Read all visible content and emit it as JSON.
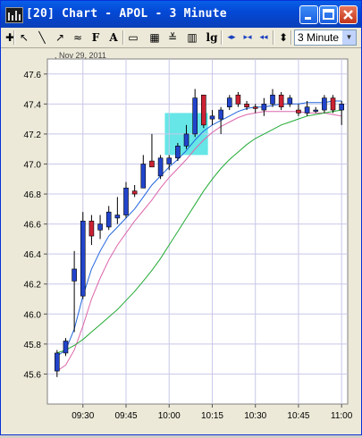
{
  "window": {
    "title": "[20] Chart - APOL - 3 Minute",
    "title_color": "#ffffff",
    "titlebar_color": "#0349d6"
  },
  "toolbar": {
    "tools": [
      {
        "name": "crosshair-icon",
        "glyph": "✚"
      },
      {
        "name": "pointer-icon",
        "glyph": "↖"
      },
      {
        "name": "line-icon",
        "glyph": "╲"
      },
      {
        "name": "ray-icon",
        "glyph": "↗"
      },
      {
        "name": "trend-icon",
        "glyph": "≈"
      },
      {
        "name": "fibonacci-icon",
        "glyph": "F"
      },
      {
        "name": "text-icon",
        "glyph": "A"
      },
      {
        "name": "page-icon",
        "glyph": "▭"
      },
      {
        "name": "grid-icon",
        "glyph": "▦"
      },
      {
        "name": "indicator-icon",
        "glyph": "≚"
      },
      {
        "name": "bars-icon",
        "glyph": "▥"
      },
      {
        "name": "log-scale-label",
        "glyph": "lg"
      },
      {
        "name": "scroll-both-icon",
        "glyph": "◂▸"
      },
      {
        "name": "scroll-left-icon",
        "glyph": "▸◂"
      },
      {
        "name": "scroll-end-icon",
        "glyph": "◂◂"
      },
      {
        "name": "zoom-icon",
        "glyph": "⬍"
      }
    ],
    "interval": "3 Minute"
  },
  "chart_data": {
    "type": "candlestick",
    "symbol": "APOL",
    "date_label": "Nov 29, 2011",
    "ylim": [
      45.4,
      47.7
    ],
    "y_ticks": [
      "47.6",
      "47.4",
      "47.2",
      "47.0",
      "46.8",
      "46.6",
      "46.4",
      "46.2",
      "46.0",
      "45.8",
      "45.6"
    ],
    "y_tick_values": [
      47.6,
      47.4,
      47.2,
      47.0,
      46.8,
      46.6,
      46.4,
      46.2,
      46.0,
      45.8,
      45.6
    ],
    "x_ticks": [
      "09:30",
      "09:45",
      "10:00",
      "10:15",
      "10:30",
      "10:45",
      "11:00"
    ],
    "x_tick_bars": [
      3,
      8,
      13,
      18,
      23,
      28,
      33
    ],
    "grid": true,
    "up_color": "#2244cc",
    "down_color": "#cc2233",
    "candles": [
      {
        "o": 45.62,
        "h": 45.76,
        "l": 45.58,
        "c": 45.74
      },
      {
        "o": 45.74,
        "h": 45.84,
        "l": 45.72,
        "c": 45.82
      },
      {
        "o": 46.22,
        "h": 46.42,
        "l": 45.88,
        "c": 46.3
      },
      {
        "o": 46.12,
        "h": 46.68,
        "l": 46.1,
        "c": 46.62
      },
      {
        "o": 46.62,
        "h": 46.66,
        "l": 46.46,
        "c": 46.52
      },
      {
        "o": 46.56,
        "h": 46.66,
        "l": 46.5,
        "c": 46.6
      },
      {
        "o": 46.58,
        "h": 46.72,
        "l": 46.56,
        "c": 46.68
      },
      {
        "o": 46.64,
        "h": 46.78,
        "l": 46.6,
        "c": 46.66
      },
      {
        "o": 46.66,
        "h": 46.88,
        "l": 46.64,
        "c": 46.84
      },
      {
        "o": 46.82,
        "h": 46.86,
        "l": 46.78,
        "c": 46.8
      },
      {
        "o": 46.84,
        "h": 47.06,
        "l": 46.84,
        "c": 47.0
      },
      {
        "o": 47.02,
        "h": 47.2,
        "l": 46.98,
        "c": 46.98
      },
      {
        "o": 46.92,
        "h": 47.06,
        "l": 46.9,
        "c": 47.04
      },
      {
        "o": 47.0,
        "h": 47.06,
        "l": 46.96,
        "c": 47.04
      },
      {
        "o": 47.04,
        "h": 47.14,
        "l": 47.02,
        "c": 47.12
      },
      {
        "o": 47.12,
        "h": 47.26,
        "l": 47.1,
        "c": 47.2
      },
      {
        "o": 47.2,
        "h": 47.5,
        "l": 47.18,
        "c": 47.44
      },
      {
        "o": 47.46,
        "h": 47.46,
        "l": 47.24,
        "c": 47.26
      },
      {
        "o": 47.3,
        "h": 47.36,
        "l": 47.26,
        "c": 47.32
      },
      {
        "o": 47.3,
        "h": 47.38,
        "l": 47.2,
        "c": 47.36
      },
      {
        "o": 47.38,
        "h": 47.46,
        "l": 47.36,
        "c": 47.44
      },
      {
        "o": 47.46,
        "h": 47.48,
        "l": 47.38,
        "c": 47.4
      },
      {
        "o": 47.4,
        "h": 47.42,
        "l": 47.36,
        "c": 47.38
      },
      {
        "o": 47.38,
        "h": 47.4,
        "l": 47.34,
        "c": 47.37
      },
      {
        "o": 47.36,
        "h": 47.44,
        "l": 47.32,
        "c": 47.4
      },
      {
        "o": 47.4,
        "h": 47.5,
        "l": 47.38,
        "c": 47.46
      },
      {
        "o": 47.46,
        "h": 47.48,
        "l": 47.36,
        "c": 47.38
      },
      {
        "o": 47.4,
        "h": 47.46,
        "l": 47.38,
        "c": 47.44
      },
      {
        "o": 47.36,
        "h": 47.4,
        "l": 47.32,
        "c": 47.34
      },
      {
        "o": 47.34,
        "h": 47.42,
        "l": 47.32,
        "c": 47.38
      },
      {
        "o": 47.36,
        "h": 47.38,
        "l": 47.34,
        "c": 47.36
      },
      {
        "o": 47.36,
        "h": 47.46,
        "l": 47.34,
        "c": 47.44
      },
      {
        "o": 47.44,
        "h": 47.46,
        "l": 47.34,
        "c": 47.36
      },
      {
        "o": 47.36,
        "h": 47.42,
        "l": 47.26,
        "c": 47.4
      }
    ],
    "series": [
      {
        "color": "#2266dd",
        "values": [
          45.72,
          45.76,
          45.9,
          46.12,
          46.3,
          46.42,
          46.52,
          46.58,
          46.64,
          46.7,
          46.78,
          46.86,
          46.92,
          46.98,
          47.03,
          47.09,
          47.16,
          47.22,
          47.26,
          47.29,
          47.32,
          47.35,
          47.37,
          47.38,
          47.38,
          47.39,
          47.4,
          47.4,
          47.4,
          47.41,
          47.41,
          47.41,
          47.42,
          47.42
        ]
      },
      {
        "color": "#dd66aa",
        "values": [
          45.62,
          45.66,
          45.76,
          45.92,
          46.1,
          46.24,
          46.36,
          46.46,
          46.54,
          46.62,
          46.69,
          46.76,
          46.84,
          46.91,
          46.97,
          47.03,
          47.1,
          47.16,
          47.21,
          47.25,
          47.28,
          47.31,
          47.33,
          47.34,
          47.35,
          47.35,
          47.35,
          47.35,
          47.35,
          47.34,
          47.34,
          47.34,
          47.33,
          47.32
        ]
      },
      {
        "color": "#22aa33",
        "values": [
          45.74,
          45.76,
          45.79,
          45.83,
          45.88,
          45.93,
          45.98,
          46.03,
          46.09,
          46.15,
          46.22,
          46.29,
          46.37,
          46.46,
          46.55,
          46.64,
          46.73,
          46.82,
          46.9,
          46.97,
          47.03,
          47.08,
          47.13,
          47.17,
          47.2,
          47.23,
          47.26,
          47.28,
          47.3,
          47.32,
          47.33,
          47.34,
          47.35,
          47.36
        ]
      }
    ],
    "highlight": {
      "from_bar": 13,
      "to_bar": 17,
      "y_from": 47.06,
      "y_to": 47.34,
      "color": "#33dddd"
    }
  }
}
